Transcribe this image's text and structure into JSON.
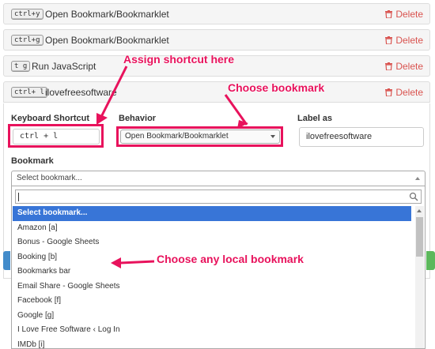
{
  "rows": [
    {
      "shortcut": "ctrl+y",
      "label": "Open Bookmark/Bookmarklet",
      "delete": "Delete"
    },
    {
      "shortcut": "ctrl+g",
      "label": "Open Bookmark/Bookmarklet",
      "delete": "Delete"
    },
    {
      "shortcut": "t g",
      "label": "Run JavaScript",
      "delete": "Delete"
    },
    {
      "shortcut": "ctrl+ l",
      "label": "ilovefreesoftware",
      "delete": "Delete"
    }
  ],
  "form": {
    "keyboard_label": "Keyboard Shortcut",
    "keyboard_value": "ctrl + l",
    "behavior_label": "Behavior",
    "behavior_value": "Open Bookmark/Bookmarklet",
    "label_label": "Label as",
    "label_value": "ilovefreesoftware",
    "bookmark_label": "Bookmark",
    "bookmark_placeholder": "Select bookmark..."
  },
  "dropdown": {
    "search_value": "",
    "options": [
      "Select bookmark...",
      "Amazon [a]",
      "Bonus - Google Sheets",
      "Booking [b]",
      "Bookmarks bar",
      "Email Share - Google Sheets",
      "Facebook [f]",
      "Google [g]",
      "I Love Free Software ‹ Log In",
      "IMDb [i]"
    ],
    "selected_index": 0
  },
  "annotations": {
    "assign": "Assign shortcut here",
    "choose_bookmark": "Choose bookmark",
    "choose_local": "Choose any local bookmark"
  },
  "colors": {
    "accent": "#e8125c",
    "delete": "#d9534f",
    "selected": "#3875d7"
  },
  "icons": [
    "trash-icon",
    "search-icon",
    "caret-down-icon",
    "caret-up-icon",
    "arrow-icon"
  ]
}
